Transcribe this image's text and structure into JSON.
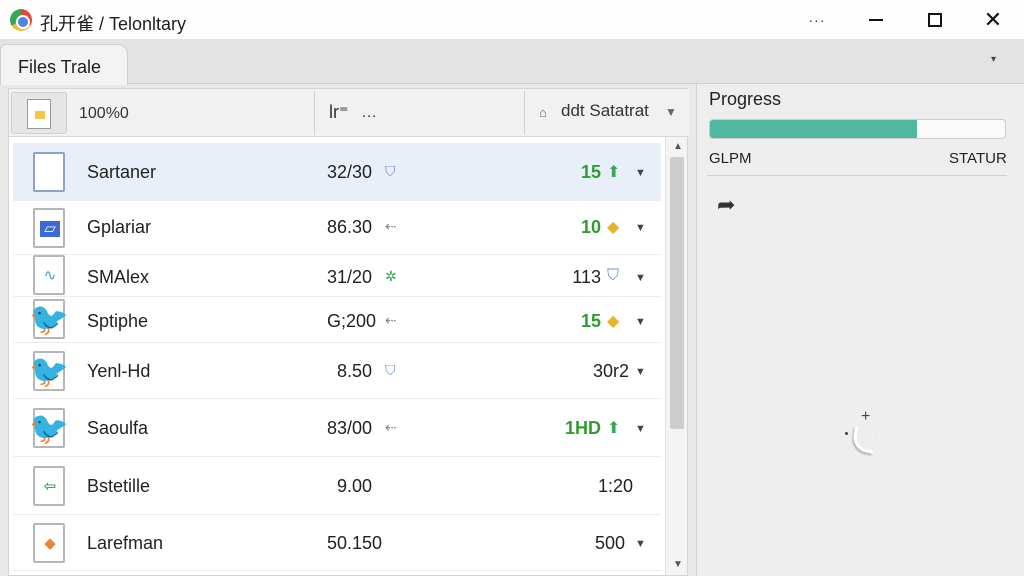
{
  "window": {
    "title": "孔开雀 / Telonltary",
    "more_label": "···",
    "close_glyph": "✕"
  },
  "tab": {
    "label": "Files Trale",
    "menu_glyph": "▾"
  },
  "header": {
    "col1": "100%0",
    "col2a": "lr⁼",
    "col2b": "…",
    "col3_icon": "⌂",
    "col3": "ddt Satatrat",
    "col3_arrow": "▼"
  },
  "rows": [
    {
      "name": "Sartaner",
      "value": "32/30",
      "mark": "shield-check",
      "count": "15",
      "count_style": "green",
      "badge": "up-arrow"
    },
    {
      "name": "Gplariar",
      "value": "86.30",
      "mark": "arrow-left",
      "count": "10",
      "count_style": "green",
      "badge": "gold-gem"
    },
    {
      "name": "SMAlex",
      "value": "31/20",
      "mark": "green-star",
      "count": "113",
      "count_style": "plain",
      "badge": "shield-check"
    },
    {
      "name": "Sptiphe",
      "value": "G;200",
      "mark": "arrow-left",
      "count": "15",
      "count_style": "green",
      "badge": "gold-gem"
    },
    {
      "name": "Yenl-Hd",
      "value": "8.50",
      "mark": "shield-check",
      "count": "30r2",
      "count_style": "plain",
      "badge": ""
    },
    {
      "name": "Saoulfa",
      "value": "83/00",
      "mark": "arrow-left",
      "count": "1HD",
      "count_style": "green",
      "badge": "up-arrow"
    },
    {
      "name": "Bstetille",
      "value": "9.00",
      "mark": "",
      "count": "1:20",
      "count_style": "plain",
      "badge": ""
    },
    {
      "name": "Larefman",
      "value": "50.150",
      "mark": "",
      "count": "500",
      "count_style": "plain",
      "badge": ""
    }
  ],
  "progress": {
    "title": "Progress",
    "percent": 70,
    "fill_color": "#4fb89f",
    "left_label": "GLPM",
    "right_label": "STATUR"
  },
  "colors": {
    "selection": "#e9eff9",
    "green_text": "#2f9d2f"
  }
}
